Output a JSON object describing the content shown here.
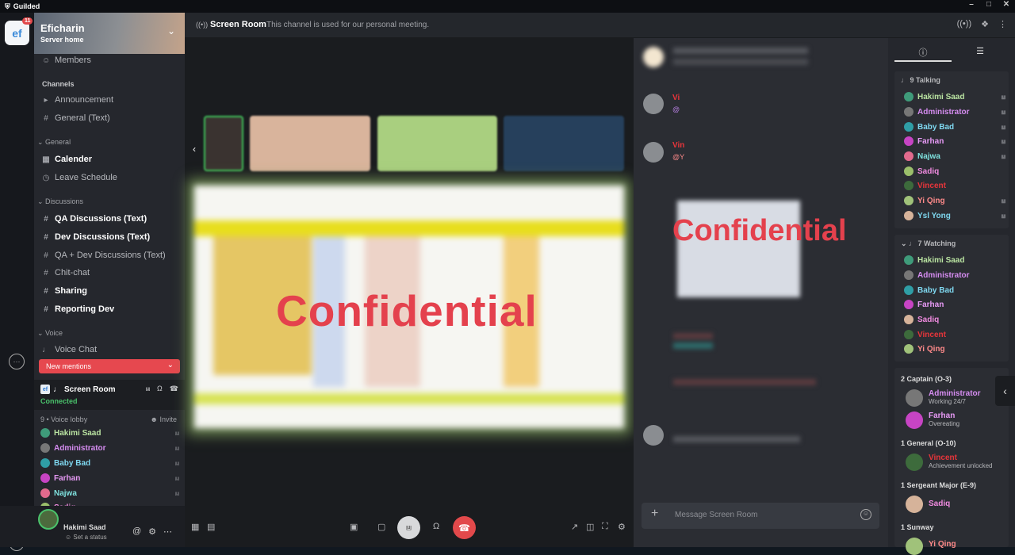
{
  "app": {
    "title": "Guilded"
  },
  "server": {
    "name": "Eficharin",
    "subtitle": "Server home",
    "badge": "11"
  },
  "nav": {
    "members": "Members",
    "channels_header": "Channels",
    "announcement": "Announcement",
    "general_text": "General (Text)",
    "cat_general": "General",
    "calender": "Calender",
    "leave": "Leave Schedule",
    "cat_discussions": "Discussions",
    "qa": "QA Discussions (Text)",
    "dev": "Dev Discussions (Text)",
    "qadev": "QA + Dev Discussions (Text)",
    "chitchat": "Chit-chat",
    "sharing": "Sharing",
    "reporting": "Reporting Dev",
    "cat_voice": "Voice",
    "voice_chat": "Voice Chat"
  },
  "new_mentions": "New mentions",
  "voice": {
    "room": "Screen Room",
    "status": "Connected",
    "lobby": "9 • Voice lobby",
    "invite": "Invite"
  },
  "voice_members": [
    "Hakimi Saad",
    "Administrator",
    "Baby Bad",
    "Farhan",
    "Najwa",
    "Sadiq"
  ],
  "user": {
    "name": "Hakimi Saad",
    "status": "Set a status"
  },
  "header": {
    "channel": "Screen Room",
    "description": "This channel is used for our personal meeting."
  },
  "stage": {
    "watermark": "Confidential"
  },
  "chat": {
    "watermark": "Confidential",
    "placeholder": "Message Screen Room",
    "names": [
      "Vi",
      "Vin"
    ],
    "mentions": [
      "@",
      "@Y"
    ]
  },
  "talking": {
    "title": "9 Talking",
    "members": [
      "Hakimi Saad",
      "Administrator",
      "Baby Bad",
      "Farhan",
      "Najwa",
      "Sadiq",
      "Vincent",
      "Yi Qing",
      "Ysl Yong"
    ]
  },
  "watching": {
    "title": "7 Watching",
    "members": [
      "Hakimi Saad",
      "Administrator",
      "Baby Bad",
      "Farhan",
      "Sadiq",
      "Vincent",
      "Yi Qing"
    ]
  },
  "roles": {
    "captain": "2 Captain (O-3)",
    "captain_members": [
      {
        "name": "Administrator",
        "status": "Working 24/7"
      },
      {
        "name": "Farhan",
        "status": "Overeating"
      }
    ],
    "general": "1 General (O-10)",
    "general_members": [
      {
        "name": "Vincent",
        "status": "Achievement unlocked"
      }
    ],
    "sergeant": "1 Sergeant Major (E-9)",
    "sergeant_members": [
      {
        "name": "Sadiq"
      }
    ],
    "sunway": "1 Sunway",
    "sunway_members": [
      {
        "name": "Yi Qing"
      }
    ]
  },
  "colors": {
    "hakimi": "#b9e3a1",
    "administrator": "#d58cf0",
    "baby_bad": "#7fd8f0",
    "farhan": "#e79af5",
    "najwa": "#7fe2df",
    "sadiq": "#f08be0",
    "vincent": "#e8353b",
    "yi_qing": "#ff8a8a",
    "ysl": "#7fd8f0"
  }
}
